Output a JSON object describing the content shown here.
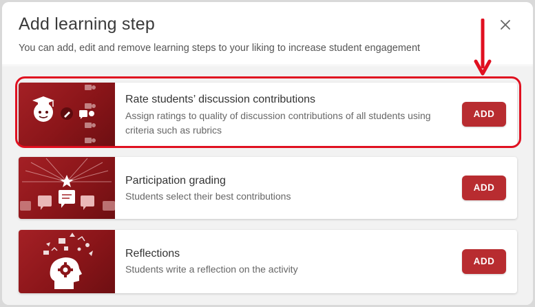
{
  "dialog": {
    "title": "Add learning step",
    "subtitle": "You can add, edit and remove learning steps to your liking to increase student engagement",
    "close_icon": "close-icon"
  },
  "steps": [
    {
      "title": "Rate students’ discussion contributions",
      "description": "Assign ratings to quality of discussion contributions of all students using criteria such as rubrics",
      "button": "ADD",
      "icon": "graduate-rating-illustration",
      "highlighted": true
    },
    {
      "title": "Participation grading",
      "description": "Students select their best contributions",
      "button": "ADD",
      "icon": "star-comments-illustration"
    },
    {
      "title": "Reflections",
      "description": "Students write a reflection on the activity",
      "button": "ADD",
      "icon": "head-gear-illustration"
    }
  ],
  "colors": {
    "accent": "#b82c30",
    "thumb_red": "#a42025",
    "annotation_red": "#e01020"
  }
}
